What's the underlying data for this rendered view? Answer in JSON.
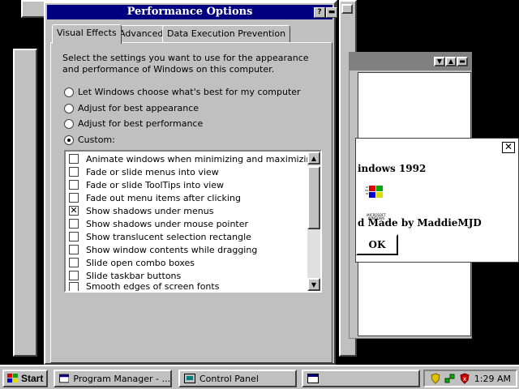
{
  "colors": {
    "desktop": "#000000",
    "face": "#c0c0c0",
    "title_active": "#000080",
    "title_inactive": "#808080"
  },
  "perf_dialog": {
    "title": "Performance Options",
    "help_btn": "?",
    "tabs": [
      "Visual Effects",
      "Advanced",
      "Data Execution Prevention"
    ],
    "description": "Select the settings you want to use for the appearance and performance of Windows on this computer.",
    "radios": [
      {
        "label": "Let Windows choose what's best for my computer",
        "selected": false
      },
      {
        "label": "Adjust for best appearance",
        "selected": false
      },
      {
        "label": "Adjust for best performance",
        "selected": false
      },
      {
        "label": "Custom:",
        "selected": true
      }
    ],
    "effects": [
      {
        "label": "Animate windows when minimizing and maximizing",
        "checked": false
      },
      {
        "label": "Fade or slide menus into view",
        "checked": false
      },
      {
        "label": "Fade or slide ToolTips into view",
        "checked": false
      },
      {
        "label": "Fade out menu items after clicking",
        "checked": false
      },
      {
        "label": "Show shadows under menus",
        "checked": true
      },
      {
        "label": "Show shadows under mouse pointer",
        "checked": false
      },
      {
        "label": "Show translucent selection rectangle",
        "checked": false
      },
      {
        "label": "Show window contents while dragging",
        "checked": false
      },
      {
        "label": "Slide open combo boxes",
        "checked": false
      },
      {
        "label": "Slide taskbar buttons",
        "checked": false
      },
      {
        "label": "Smooth edges of screen fonts",
        "checked": false
      }
    ],
    "check_mark": "✕"
  },
  "about_window": {
    "title_fragment": "indows 1992",
    "credit_fragment": "d Made by MaddieMJD",
    "ok_label": "OK",
    "close_glyph": "✕",
    "logo_text": "MICROSOFT WINDOWS"
  },
  "taskbar": {
    "start_label": "Start",
    "tasks": [
      "Program Manager - ...",
      "Control Panel",
      ""
    ],
    "clock": "1:29 AM"
  }
}
